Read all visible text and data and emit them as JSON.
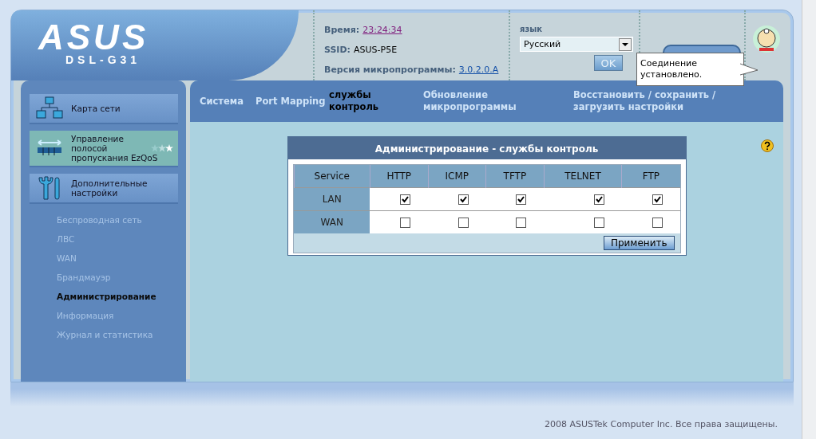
{
  "header": {
    "logo": "ASUS",
    "model": "DSL-G31",
    "info": [
      {
        "label": "Время:",
        "value": "23:24:34",
        "kind": "visited-link"
      },
      {
        "label": "SSID:",
        "value": "ASUS-P5E",
        "kind": "text"
      },
      {
        "label": "Версия микропрограммы:",
        "value": "3.0.2.0.A",
        "kind": "link"
      }
    ],
    "language": {
      "label": "язык",
      "value": "Русский",
      "button": "OK"
    },
    "tooltip": "Соединение установлено."
  },
  "sidebar": {
    "items": [
      {
        "label": "Карта сети",
        "kind": "network",
        "selected": false
      },
      {
        "label": "Управление полосой пропускания EzQoS",
        "kind": "qos",
        "selected": true
      },
      {
        "label": "Дополнительные настройки",
        "kind": "tools",
        "selected": false
      }
    ],
    "submenu": [
      {
        "label": "Беспроводная сеть",
        "selected": false
      },
      {
        "label": "ЛВС",
        "selected": false
      },
      {
        "label": "WAN",
        "selected": false
      },
      {
        "label": "Брандмауэр",
        "selected": false
      },
      {
        "label": "Администрирование",
        "selected": true
      },
      {
        "label": "Информация",
        "selected": false
      },
      {
        "label": "Журнал и статистика",
        "selected": false
      }
    ]
  },
  "tabs": [
    {
      "label": "Система",
      "selected": false
    },
    {
      "label": "Port Mapping",
      "selected": false
    },
    {
      "label": "службы контроль",
      "selected": true
    },
    {
      "label": "Обновление микропрограммы",
      "selected": false
    },
    {
      "label": "Восстановить / сохранить / загрузить настройки",
      "selected": false
    }
  ],
  "panel": {
    "title": "Администрирование - службы контроль",
    "columns": [
      "Service",
      "HTTP",
      "ICMP",
      "TFTP",
      "TELNET",
      "FTP"
    ],
    "rows": [
      {
        "name": "LAN",
        "checks": [
          true,
          true,
          true,
          true,
          true
        ]
      },
      {
        "name": "WAN",
        "checks": [
          false,
          false,
          false,
          false,
          false
        ]
      }
    ],
    "button": "Применить"
  },
  "footer": "2008 ASUSTek Computer Inc. Все права защищены."
}
